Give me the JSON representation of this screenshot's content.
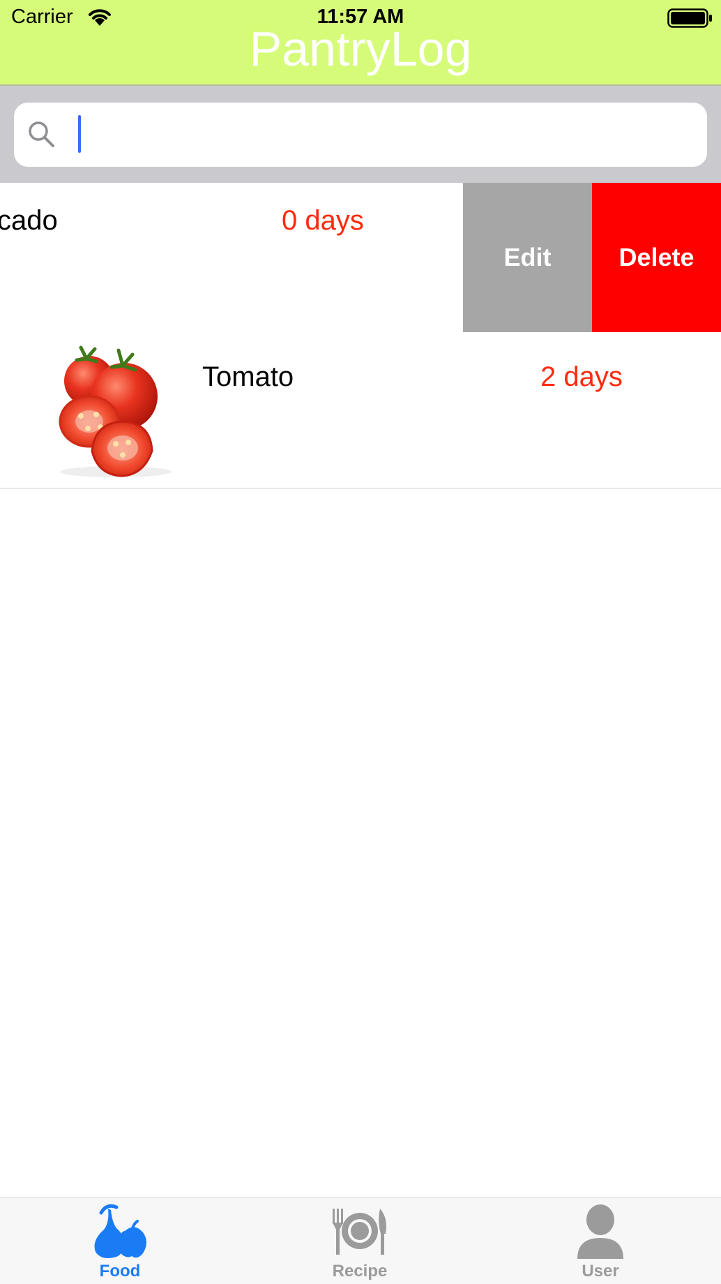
{
  "status_bar": {
    "carrier": "Carrier",
    "time": "11:57 AM"
  },
  "header": {
    "title": "PantryLog",
    "background": "#d5fb79"
  },
  "search": {
    "value": "",
    "placeholder": ""
  },
  "rows": [
    {
      "name": "cado",
      "days": "0 days",
      "actions": {
        "edit": "Edit",
        "delete": "Delete"
      }
    },
    {
      "name": "Tomato",
      "days": "2 days",
      "image": "tomato-image"
    }
  ],
  "tabs": [
    {
      "label": "Food",
      "icon": "food-icon",
      "active": true
    },
    {
      "label": "Recipe",
      "icon": "recipe-icon",
      "active": false
    },
    {
      "label": "User",
      "icon": "user-icon",
      "active": false
    }
  ],
  "colors": {
    "accent": "#1a7cf5",
    "days_red": "#ff2a0f",
    "edit_gray": "#a6a6a6",
    "delete_red": "#ff0000",
    "inactive_tab": "#9b9b9b"
  }
}
